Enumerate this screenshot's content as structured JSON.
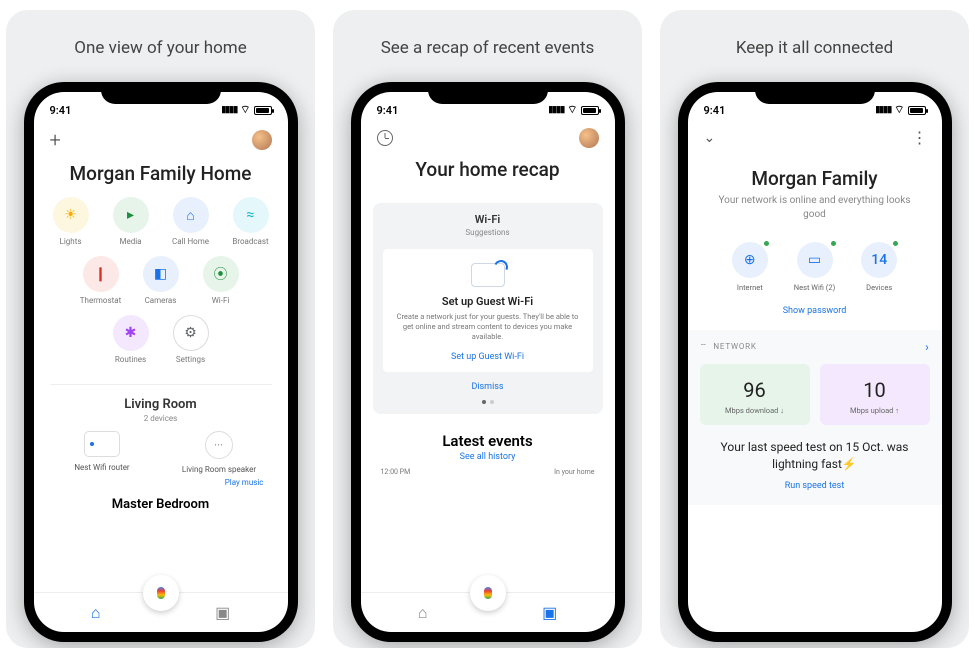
{
  "status_time": "9:41",
  "panels": [
    {
      "title": "One view of your home"
    },
    {
      "title": "See a recap of recent events"
    },
    {
      "title": "Keep it all connected"
    }
  ],
  "p1": {
    "home_name": "Morgan Family Home",
    "shortcuts": [
      {
        "label": "Lights",
        "bg": "bg-yellow",
        "fg": "fg-yellow",
        "glyph": "💡"
      },
      {
        "label": "Media",
        "bg": "bg-green",
        "fg": "fg-green",
        "glyph": "▶"
      },
      {
        "label": "Call Home",
        "bg": "bg-blue",
        "fg": "fg-blue",
        "glyph": "⌂"
      },
      {
        "label": "Broadcast",
        "bg": "bg-cyan",
        "fg": "fg-cyan",
        "glyph": "≈"
      },
      {
        "label": "Thermostat",
        "bg": "bg-red",
        "fg": "fg-red",
        "glyph": "🌡"
      },
      {
        "label": "Cameras",
        "bg": "bg-blue",
        "fg": "fg-blue",
        "glyph": "◉"
      },
      {
        "label": "Wi-Fi",
        "bg": "bg-green",
        "fg": "fg-green",
        "glyph": "⦿"
      },
      {
        "label": "Routines",
        "bg": "bg-purple",
        "fg": "fg-purple",
        "glyph": "✱"
      },
      {
        "label": "Settings",
        "bg": "bg-white",
        "fg": "fg-grey",
        "glyph": "⚙"
      }
    ],
    "room1": {
      "name": "Living Room",
      "sub": "2 devices"
    },
    "devices": [
      {
        "name": "Nest Wifi router"
      },
      {
        "name": "Living Room speaker"
      }
    ],
    "play_music": "Play music",
    "room2": "Master Bedroom"
  },
  "p2": {
    "title": "Your home recap",
    "card": {
      "tag": "Wi-Fi",
      "sub": "Suggestions",
      "heading": "Set up Guest Wi-Fi",
      "body": "Create a network just for your guests. They'll be able to get online and stream content to devices you make available.",
      "cta": "Set up Guest Wi-Fi",
      "dismiss": "Dismiss"
    },
    "latest": "Latest events",
    "see_all": "See all history",
    "event_time": "12:00 PM",
    "event_text": "In your home"
  },
  "p3": {
    "title": "Morgan Family",
    "sub": "Your network is online and everything looks good",
    "stats": [
      {
        "label": "Internet",
        "glyph": "🌐",
        "num": ""
      },
      {
        "label": "Nest Wifi (2)",
        "glyph": "▭",
        "num": ""
      },
      {
        "label": "Devices",
        "glyph": "",
        "num": "14"
      }
    ],
    "show_pw": "Show password",
    "network_tag": "NETWORK",
    "speed": {
      "down": "96",
      "down_l": "Mbps download ↓",
      "up": "10",
      "up_l": "Mbps upload ↑"
    },
    "last_test": "Your last speed test on 15 Oct. was lightning fast⚡",
    "run_test": "Run speed test"
  }
}
